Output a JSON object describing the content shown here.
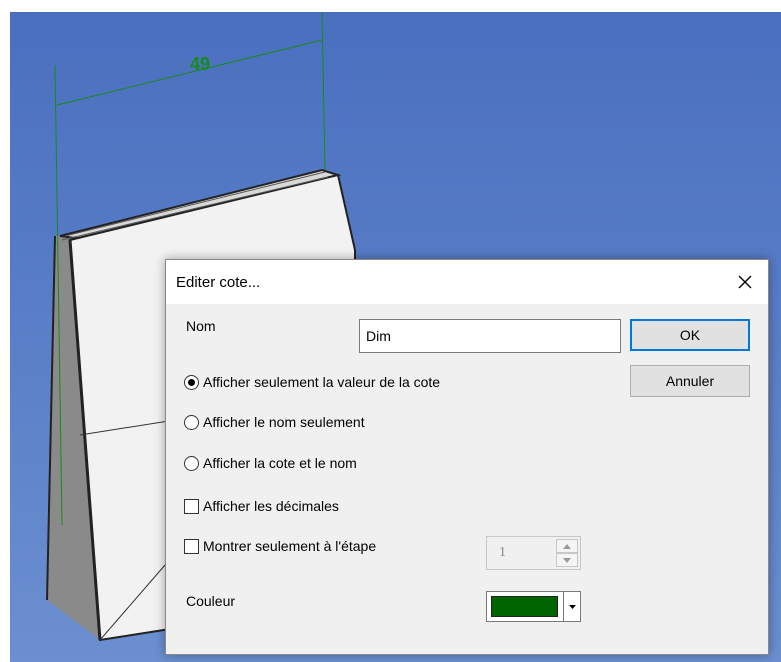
{
  "scene": {
    "dimension_value": "49",
    "background_color": "#5b7fc4",
    "dimension_color": "#1a8a1a"
  },
  "dialog": {
    "title": "Editer cote...",
    "name_label": "Nom",
    "name_value": "Dim",
    "ok_label": "OK",
    "cancel_label": "Annuler",
    "radio_options": [
      {
        "label": "Afficher seulement la valeur de la cote",
        "selected": true
      },
      {
        "label": "Afficher le nom seulement",
        "selected": false
      },
      {
        "label": "Afficher la cote et le nom",
        "selected": false
      }
    ],
    "show_decimals_label": "Afficher les décimales",
    "show_decimals_checked": false,
    "step_only_label": "Montrer seulement à l'étape",
    "step_only_checked": false,
    "step_value": "1",
    "color_label": "Couleur",
    "color_value": "#006400",
    "icons": {
      "close": "close-icon",
      "spin_up": "chevron-up-icon",
      "spin_down": "chevron-down-icon",
      "dropdown": "dropdown-arrow-icon"
    }
  }
}
